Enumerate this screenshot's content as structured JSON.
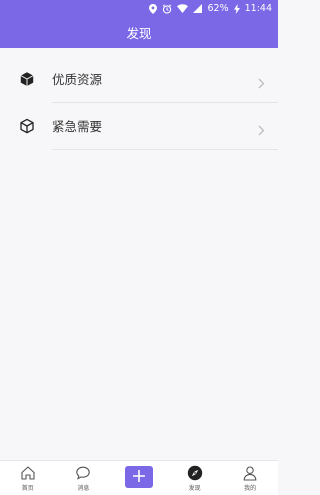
{
  "status_bar": {
    "battery": "62%",
    "time": "11:44"
  },
  "header": {
    "title": "发现"
  },
  "list": {
    "items": [
      {
        "label": "优质资源",
        "icon": "cube-filled-icon"
      },
      {
        "label": "紧急需要",
        "icon": "cube-outline-icon"
      }
    ]
  },
  "tabbar": {
    "tabs": [
      {
        "label": "首页",
        "icon": "home-icon"
      },
      {
        "label": "消息",
        "icon": "chat-bubble-icon"
      },
      {
        "label": "",
        "icon": "plus-icon"
      },
      {
        "label": "发现",
        "icon": "compass-icon",
        "active": true
      },
      {
        "label": "我的",
        "icon": "user-icon"
      }
    ]
  },
  "colors": {
    "accent": "#7b68e6",
    "background": "#f7f7f9",
    "divider": "#e4e4e8"
  }
}
